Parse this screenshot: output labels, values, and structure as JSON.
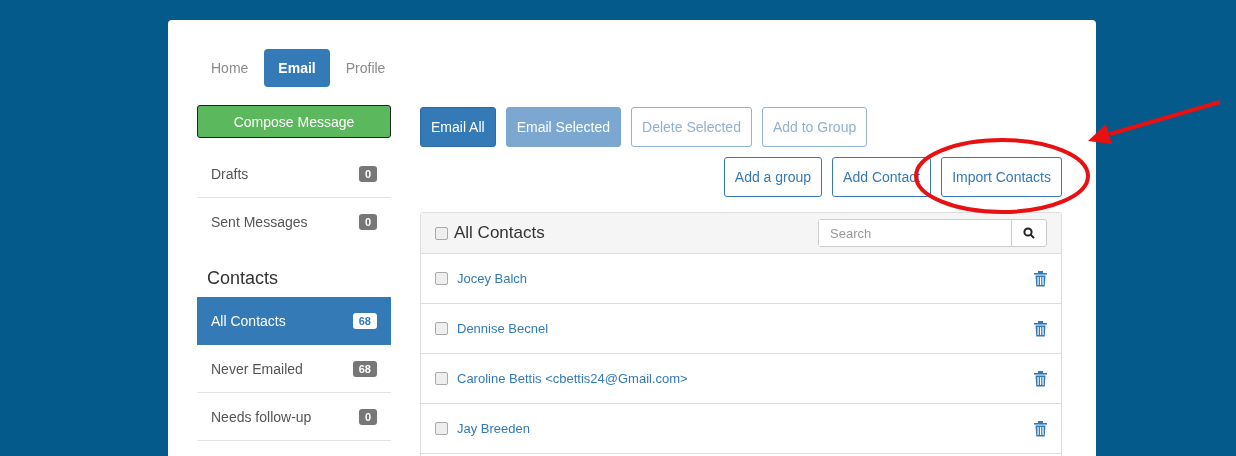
{
  "nav_tabs": [
    {
      "label": "Home",
      "selected": false
    },
    {
      "label": "Email",
      "selected": true
    },
    {
      "label": "Profile",
      "selected": false
    }
  ],
  "compose_button": "Compose Message",
  "mail_folders": [
    {
      "label": "Drafts",
      "count": "0",
      "selected": false
    },
    {
      "label": "Sent Messages",
      "count": "0",
      "selected": false
    }
  ],
  "contacts_heading": "Contacts",
  "contact_groups": [
    {
      "label": "All Contacts",
      "count": "68",
      "selected": true
    },
    {
      "label": "Never Emailed",
      "count": "68",
      "selected": false
    },
    {
      "label": "Needs follow-up",
      "count": "0",
      "selected": false
    }
  ],
  "toolbar_row_1": [
    {
      "label": "Email All",
      "kind": "primary",
      "disabled": false
    },
    {
      "label": "Email Selected",
      "kind": "primary",
      "disabled": true
    },
    {
      "label": "Delete Selected",
      "kind": "outline",
      "disabled": true
    },
    {
      "label": "Add to Group",
      "kind": "outline",
      "disabled": true
    }
  ],
  "toolbar_row_2": [
    {
      "label": "Add a group",
      "kind": "outline",
      "disabled": false
    },
    {
      "label": "Add Contact",
      "kind": "outline",
      "disabled": false
    },
    {
      "label": "Import Contacts",
      "kind": "outline",
      "disabled": false
    }
  ],
  "contacts_panel": {
    "title": "All Contacts",
    "select_all_checked": false,
    "search": {
      "placeholder": "Search"
    },
    "rows": [
      {
        "name": "Jocey Balch",
        "checked": false
      },
      {
        "name": "Dennise Becnel",
        "checked": false
      },
      {
        "name": "Caroline Bettis <cbettis24@Gmail.com>",
        "checked": false
      },
      {
        "name": "Jay Breeden",
        "checked": false
      }
    ]
  }
}
